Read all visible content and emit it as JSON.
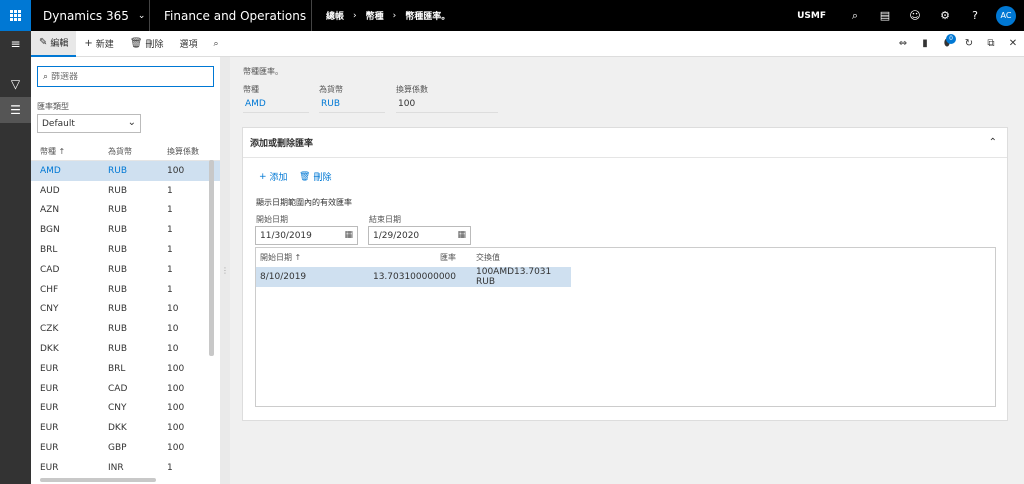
{
  "topbar": {
    "app_name": "Dynamics 365",
    "module": "Finance and Operations",
    "breadcrumb": [
      "總帳",
      "幣種",
      "幣種匯率。"
    ],
    "company": "USMF",
    "avatar_initials": "AC"
  },
  "actions": {
    "edit": "編輯",
    "new": "新建",
    "delete": "刪除",
    "options": "選項",
    "notification_count": "0"
  },
  "left": {
    "filter_placeholder": "篩選器",
    "rate_type_label": "匯率類型",
    "rate_type_value": "Default",
    "columns": [
      "幣種",
      "為貨幣",
      "換算係數"
    ],
    "rows": [
      {
        "from": "AMD",
        "to": "RUB",
        "factor": "100"
      },
      {
        "from": "AUD",
        "to": "RUB",
        "factor": "1"
      },
      {
        "from": "AZN",
        "to": "RUB",
        "factor": "1"
      },
      {
        "from": "BGN",
        "to": "RUB",
        "factor": "1"
      },
      {
        "from": "BRL",
        "to": "RUB",
        "factor": "1"
      },
      {
        "from": "CAD",
        "to": "RUB",
        "factor": "1"
      },
      {
        "from": "CHF",
        "to": "RUB",
        "factor": "1"
      },
      {
        "from": "CNY",
        "to": "RUB",
        "factor": "10"
      },
      {
        "from": "CZK",
        "to": "RUB",
        "factor": "10"
      },
      {
        "from": "DKK",
        "to": "RUB",
        "factor": "10"
      },
      {
        "from": "EUR",
        "to": "BRL",
        "factor": "100"
      },
      {
        "from": "EUR",
        "to": "CAD",
        "factor": "100"
      },
      {
        "from": "EUR",
        "to": "CNY",
        "factor": "100"
      },
      {
        "from": "EUR",
        "to": "DKK",
        "factor": "100"
      },
      {
        "from": "EUR",
        "to": "GBP",
        "factor": "100"
      },
      {
        "from": "EUR",
        "to": "INR",
        "factor": "1"
      }
    ]
  },
  "detail": {
    "title": "幣種匯率。",
    "currency_label": "幣種",
    "currency_value": "AMD",
    "to_label": "為貨幣",
    "to_value": "RUB",
    "factor_label": "換算係數",
    "factor_value": "100"
  },
  "section": {
    "title": "添加或刪除匯率",
    "add": "添加",
    "remove": "刪除",
    "hint": "顯示日期範圍內的有效匯率",
    "start_label": "開始日期",
    "start_value": "11/30/2019",
    "end_label": "結束日期",
    "end_value": "1/29/2020",
    "columns": [
      "開始日期",
      "匯率",
      "交換值"
    ],
    "rows": [
      {
        "date": "8/10/2019",
        "rate": "13.703100000000",
        "exchange": "100AMD13.7031 RUB"
      }
    ]
  }
}
